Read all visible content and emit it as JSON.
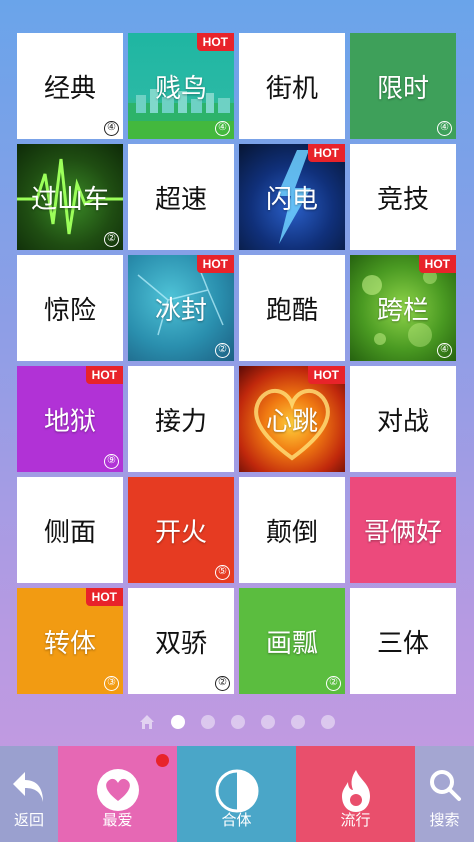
{
  "tiles": [
    {
      "label": "经典",
      "badge": "④",
      "hot": ""
    },
    {
      "label": "贱鸟",
      "badge": "④",
      "hot": "HOT"
    },
    {
      "label": "街机",
      "badge": "",
      "hot": ""
    },
    {
      "label": "限时",
      "badge": "④",
      "hot": ""
    },
    {
      "label": "过山车",
      "badge": "②",
      "hot": ""
    },
    {
      "label": "超速",
      "badge": "",
      "hot": ""
    },
    {
      "label": "闪电",
      "badge": "",
      "hot": "HOT"
    },
    {
      "label": "竞技",
      "badge": "",
      "hot": ""
    },
    {
      "label": "惊险",
      "badge": "",
      "hot": ""
    },
    {
      "label": "冰封",
      "badge": "②",
      "hot": "HOT"
    },
    {
      "label": "跑酷",
      "badge": "",
      "hot": ""
    },
    {
      "label": "跨栏",
      "badge": "④",
      "hot": "HOT"
    },
    {
      "label": "地狱",
      "badge": "⑨",
      "hot": "HOT"
    },
    {
      "label": "接力",
      "badge": "",
      "hot": ""
    },
    {
      "label": "心跳",
      "badge": "",
      "hot": "HOT"
    },
    {
      "label": "对战",
      "badge": "",
      "hot": ""
    },
    {
      "label": "侧面",
      "badge": "",
      "hot": ""
    },
    {
      "label": "开火",
      "badge": "⑤",
      "hot": ""
    },
    {
      "label": "颠倒",
      "badge": "",
      "hot": ""
    },
    {
      "label": "哥俩好",
      "badge": "",
      "hot": ""
    },
    {
      "label": "转体",
      "badge": "③",
      "hot": "HOT"
    },
    {
      "label": "双骄",
      "badge": "②",
      "hot": ""
    },
    {
      "label": "画瓢",
      "badge": "②",
      "hot": ""
    },
    {
      "label": "三体",
      "badge": "",
      "hot": ""
    }
  ],
  "pager": {
    "pages": 6,
    "current": 1
  },
  "bottom_nav": {
    "back": "返回",
    "favorites": "最爱",
    "font": "合体",
    "popular": "流行",
    "search": "搜索"
  },
  "colors": {
    "hot_badge": "#e8232a",
    "fav_tab": "#e668b4",
    "font_tab": "#4aa6c8",
    "popular_tab": "#e94f6c"
  }
}
